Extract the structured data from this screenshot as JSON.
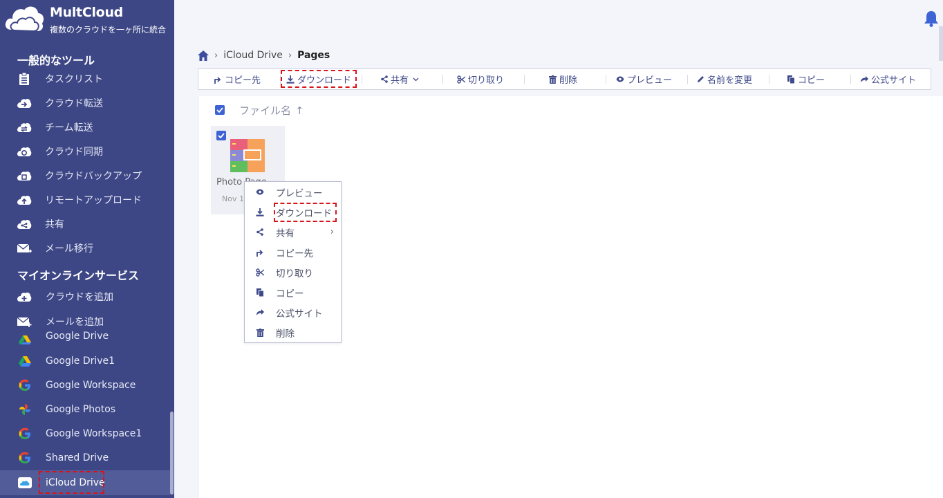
{
  "app": {
    "title": "MultCloud",
    "tagline": "複数のクラウドを一ヶ所に統合"
  },
  "sidebar": {
    "section_tools": "一般的なツール",
    "tools": [
      {
        "label": "タスクリスト",
        "icon": "clipboard-icon"
      },
      {
        "label": "クラウド転送",
        "icon": "cloud-transfer-icon"
      },
      {
        "label": "チーム転送",
        "icon": "team-transfer-icon"
      },
      {
        "label": "クラウド同期",
        "icon": "cloud-sync-icon"
      },
      {
        "label": "クラウドバックアップ",
        "icon": "cloud-backup-icon"
      },
      {
        "label": "リモートアップロード",
        "icon": "remote-upload-icon"
      },
      {
        "label": "共有",
        "icon": "share-icon"
      },
      {
        "label": "メール移行",
        "icon": "mail-migration-icon"
      }
    ],
    "section_services": "マイオンラインサービス",
    "services": [
      {
        "label": "クラウドを追加",
        "icon": "add-cloud-icon"
      },
      {
        "label": "メールを追加",
        "icon": "add-mail-icon"
      }
    ],
    "clouds": [
      {
        "label": "Google Drive",
        "icon": "google-drive-icon"
      },
      {
        "label": "Google Drive1",
        "icon": "google-drive-icon"
      },
      {
        "label": "Google Workspace",
        "icon": "google-icon"
      },
      {
        "label": "Google Photos",
        "icon": "google-photos-icon"
      },
      {
        "label": "Google Workspace1",
        "icon": "google-icon"
      },
      {
        "label": "Shared Drive",
        "icon": "google-icon"
      },
      {
        "label": "iCloud Drive",
        "icon": "icloud-icon"
      }
    ]
  },
  "breadcrumb": {
    "home_icon": "home-icon",
    "items": [
      "iCloud Drive",
      "Pages"
    ]
  },
  "toolbar": {
    "copy_to": "コピー先",
    "download": "ダウンロード",
    "share": "共有",
    "cut": "切り取り",
    "delete": "削除",
    "preview": "プレビュー",
    "rename": "名前を変更",
    "copy": "コピー",
    "official_site": "公式サイト"
  },
  "file_list": {
    "column_filename": "ファイル名",
    "sort_arrow": "↑",
    "files": [
      {
        "name": "Photo Pages",
        "name_visible": "Photo Page",
        "date": "Nov 1",
        "selected": true
      }
    ]
  },
  "context_menu": {
    "items": [
      {
        "label": "プレビュー",
        "icon": "eye-icon"
      },
      {
        "label": "ダウンロード",
        "icon": "download-icon"
      },
      {
        "label": "共有",
        "icon": "share-icon",
        "submenu": true
      },
      {
        "label": "コピー先",
        "icon": "copy-to-icon"
      },
      {
        "label": "切り取り",
        "icon": "scissors-icon"
      },
      {
        "label": "コピー",
        "icon": "copy-icon"
      },
      {
        "label": "公式サイト",
        "icon": "external-icon"
      },
      {
        "label": "削除",
        "icon": "trash-icon"
      }
    ]
  },
  "colors": {
    "sidebar_bg": "#3d4785",
    "accent": "#3e63d4",
    "highlight": "#d8141b"
  }
}
